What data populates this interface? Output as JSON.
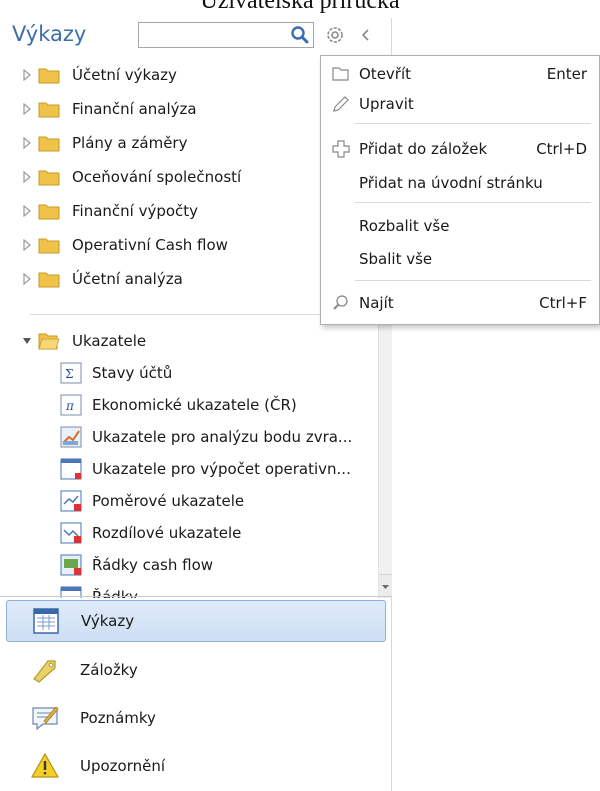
{
  "document_title": "Uživatelská příručka",
  "panel": {
    "title": "Výkazy",
    "search": {
      "value": "",
      "placeholder": ""
    },
    "icons": [
      "search-icon",
      "gear-icon",
      "collapse-panel-icon"
    ]
  },
  "tree": {
    "folders": [
      {
        "label": "Účetní výkazy"
      },
      {
        "label": "Finanční analýza"
      },
      {
        "label": "Plány a záměry"
      },
      {
        "label": "Oceňování společností"
      },
      {
        "label": "Finanční výpočty"
      },
      {
        "label": "Operativní Cash flow"
      },
      {
        "label": "Účetní analýza"
      }
    ],
    "expanded_folder": {
      "label": "Ukazatele",
      "children": [
        {
          "label": "Stavy účtů",
          "icon": "sigma-icon"
        },
        {
          "label": "Ekonomické ukazatele (ČR)",
          "icon": "pi-icon"
        },
        {
          "label": "Ukazatele pro analýzu bodu zvra...",
          "icon": "chart-icon"
        },
        {
          "label": "Ukazatele pro výpočet operativn...",
          "icon": "window-icon"
        },
        {
          "label": "Poměrové ukazatele",
          "icon": "ratio-icon"
        },
        {
          "label": "Rozdílové ukazatele",
          "icon": "diff-icon"
        },
        {
          "label": "Řádky cash flow",
          "icon": "cashflow-icon"
        },
        {
          "label": "Řádky ...",
          "icon": "window-icon"
        }
      ]
    }
  },
  "nav_buttons": [
    {
      "label": "Výkazy",
      "icon": "reports-icon",
      "active": true
    },
    {
      "label": "Záložky",
      "icon": "bookmark-icon",
      "active": false
    },
    {
      "label": "Poznámky",
      "icon": "notes-icon",
      "active": false
    },
    {
      "label": "Upozornění",
      "icon": "warning-icon",
      "active": false
    }
  ],
  "context_menu": {
    "items": [
      {
        "label": "Otevřít",
        "shortcut": "Enter",
        "icon": "open-folder-icon"
      },
      {
        "label": "Upravit",
        "shortcut": "",
        "icon": "pencil-icon"
      },
      {
        "label": "Přidat do záložek",
        "shortcut": "Ctrl+D",
        "icon": "add-icon"
      },
      {
        "label": "Přidat na úvodní stránku",
        "shortcut": "",
        "icon": ""
      },
      {
        "label": "Rozbalit vše",
        "shortcut": "",
        "icon": ""
      },
      {
        "label": "Sbalit vše",
        "shortcut": "",
        "icon": ""
      },
      {
        "label": "Najít",
        "shortcut": "Ctrl+F",
        "icon": "find-icon"
      }
    ]
  },
  "colors": {
    "accent": "#3c6ea8",
    "folder": "#f0c24a",
    "active_button": "#cddff4"
  }
}
